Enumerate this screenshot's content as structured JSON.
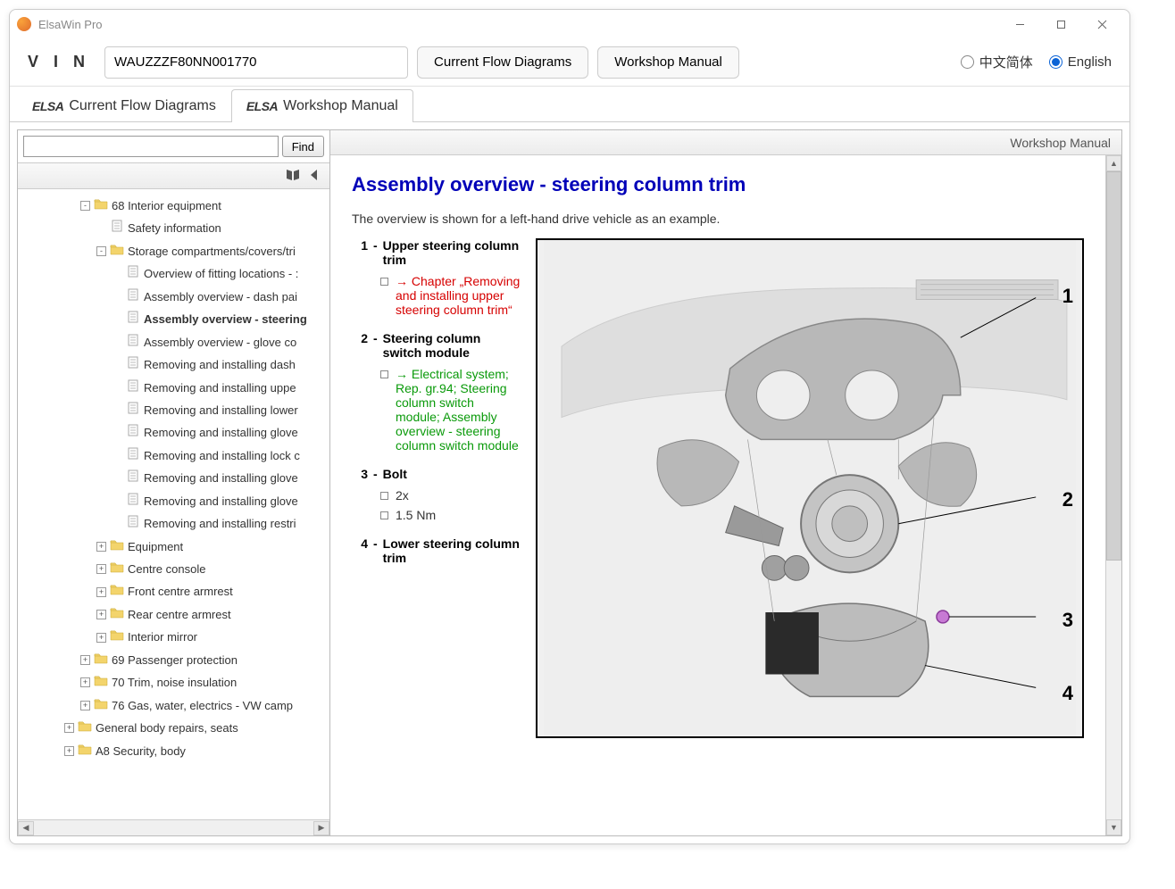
{
  "window": {
    "title": "ElsaWin Pro"
  },
  "toolbar": {
    "vin_label": "V I N",
    "vin_value": "WAUZZZF80NN001770",
    "btn_flow": "Current Flow Diagrams",
    "btn_manual": "Workshop Manual",
    "lang_cn": "中文简体",
    "lang_en": "English",
    "lang_selected": "en"
  },
  "main_tabs": {
    "elsa": "ELSA",
    "flow": "Current Flow Diagrams",
    "manual": "Workshop Manual",
    "active": 1
  },
  "sidebar": {
    "find_label": "Find",
    "search_value": "",
    "tree": [
      {
        "level": 2,
        "exp": "-",
        "type": "folder",
        "label": "68 Interior equipment"
      },
      {
        "level": 3,
        "exp": "",
        "type": "doc",
        "label": "Safety information"
      },
      {
        "level": 3,
        "exp": "-",
        "type": "folder",
        "label": "Storage compartments/covers/tri"
      },
      {
        "level": 4,
        "exp": "",
        "type": "doc",
        "label": "Overview of fitting locations - :"
      },
      {
        "level": 4,
        "exp": "",
        "type": "doc",
        "label": "Assembly overview - dash pai"
      },
      {
        "level": 4,
        "exp": "",
        "type": "doc",
        "label": "Assembly overview - steering",
        "bold": true
      },
      {
        "level": 4,
        "exp": "",
        "type": "doc",
        "label": "Assembly overview - glove co"
      },
      {
        "level": 4,
        "exp": "",
        "type": "doc",
        "label": "Removing and installing dash"
      },
      {
        "level": 4,
        "exp": "",
        "type": "doc",
        "label": "Removing and installing uppe"
      },
      {
        "level": 4,
        "exp": "",
        "type": "doc",
        "label": "Removing and installing lower"
      },
      {
        "level": 4,
        "exp": "",
        "type": "doc",
        "label": "Removing and installing glove"
      },
      {
        "level": 4,
        "exp": "",
        "type": "doc",
        "label": "Removing and installing lock c"
      },
      {
        "level": 4,
        "exp": "",
        "type": "doc",
        "label": "Removing and installing glove"
      },
      {
        "level": 4,
        "exp": "",
        "type": "doc",
        "label": "Removing and installing glove"
      },
      {
        "level": 4,
        "exp": "",
        "type": "doc",
        "label": "Removing and installing restri"
      },
      {
        "level": 3,
        "exp": "+",
        "type": "folder",
        "label": "Equipment"
      },
      {
        "level": 3,
        "exp": "+",
        "type": "folder",
        "label": "Centre console"
      },
      {
        "level": 3,
        "exp": "+",
        "type": "folder",
        "label": "Front centre armrest"
      },
      {
        "level": 3,
        "exp": "+",
        "type": "folder",
        "label": "Rear centre armrest"
      },
      {
        "level": 3,
        "exp": "+",
        "type": "folder",
        "label": "Interior mirror"
      },
      {
        "level": 2,
        "exp": "+",
        "type": "folder",
        "label": "69 Passenger protection"
      },
      {
        "level": 2,
        "exp": "+",
        "type": "folder",
        "label": "70 Trim, noise insulation"
      },
      {
        "level": 2,
        "exp": "+",
        "type": "folder",
        "label": "76 Gas, water, electrics - VW camp"
      },
      {
        "level": 1,
        "exp": "+",
        "type": "folder",
        "label": "General body repairs, seats"
      },
      {
        "level": 1,
        "exp": "+",
        "type": "folder",
        "label": "A8 Security, body"
      }
    ]
  },
  "content": {
    "header": "Workshop Manual",
    "title": "Assembly overview - steering column trim",
    "intro": "The overview is shown for a left-hand drive vehicle as an example.",
    "items": [
      {
        "num": "1",
        "title": "Upper steering column trim",
        "subs": [
          {
            "kind": "red",
            "text": "→ Chapter „Removing and installing upper steering column trim“"
          }
        ]
      },
      {
        "num": "2",
        "title": "Steering column switch module",
        "subs": [
          {
            "kind": "green",
            "text": "→ Electrical system; Rep. gr.94; Steering column switch module; Assembly overview - steering column switch module"
          }
        ]
      },
      {
        "num": "3",
        "title": "Bolt",
        "subs": [
          {
            "kind": "plain",
            "text": "2x"
          },
          {
            "kind": "plain",
            "text": "1.5 Nm"
          }
        ]
      },
      {
        "num": "4",
        "title": "Lower steering column trim",
        "subs": []
      }
    ],
    "callouts": [
      "1",
      "2",
      "3",
      "4"
    ]
  }
}
